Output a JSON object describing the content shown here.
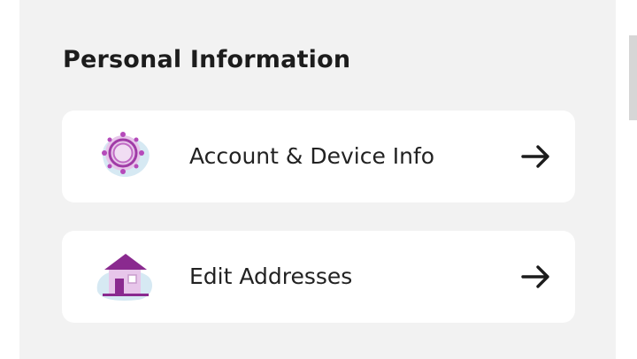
{
  "section": {
    "title": "Personal Information"
  },
  "items": [
    {
      "label": "Account & Device Info",
      "icon": "gear-icon"
    },
    {
      "label": "Edit Addresses",
      "icon": "house-icon"
    }
  ],
  "colors": {
    "panel_background": "#f2f2f2",
    "card_background": "#ffffff",
    "icon_accent": "#8a2a8f",
    "icon_light": "#e7c6ea",
    "icon_blob": "#d6e9f3"
  }
}
